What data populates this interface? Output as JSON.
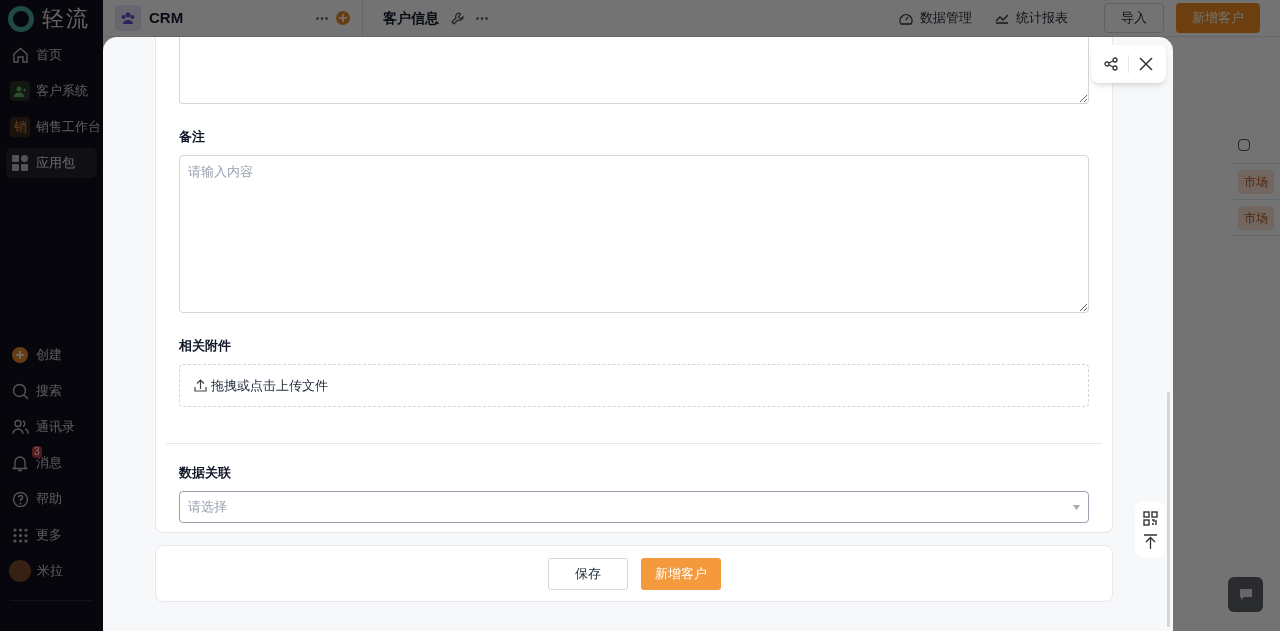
{
  "sidebar": {
    "logo": "轻流",
    "nav": [
      {
        "label": "首页",
        "selected": false
      },
      {
        "label": "客户系统",
        "selected": false
      },
      {
        "label": "销售工作台",
        "letter": "销",
        "selected": false
      },
      {
        "label": "应用包",
        "selected": true
      }
    ],
    "tools": [
      {
        "label": "创建"
      },
      {
        "label": "搜索"
      },
      {
        "label": "通讯录"
      },
      {
        "label": "消息",
        "badge": "3"
      },
      {
        "label": "帮助"
      },
      {
        "label": "更多"
      }
    ],
    "user": {
      "name": "米拉"
    }
  },
  "app_panel": {
    "title": "CRM"
  },
  "page_header": {
    "title": "客户信息",
    "links": [
      {
        "label": "数据管理"
      },
      {
        "label": "统计报表"
      }
    ],
    "import_button": "导入",
    "primary_button": "新增客户"
  },
  "background_table": {
    "tags": [
      "市场",
      "市场"
    ]
  },
  "modal": {
    "fields": [
      {
        "kind": "textarea"
      },
      {
        "kind": "textarea",
        "label": "备注",
        "placeholder": "请输入内容"
      },
      {
        "kind": "upload",
        "label": "相关附件",
        "text": "拖拽或点击上传文件"
      },
      {
        "kind": "divider"
      },
      {
        "kind": "select",
        "label": "数据关联",
        "placeholder": "请选择"
      }
    ],
    "footer_buttons": [
      {
        "label": "保存",
        "kind": "secondary"
      },
      {
        "label": "新增客户",
        "kind": "primary"
      }
    ]
  }
}
